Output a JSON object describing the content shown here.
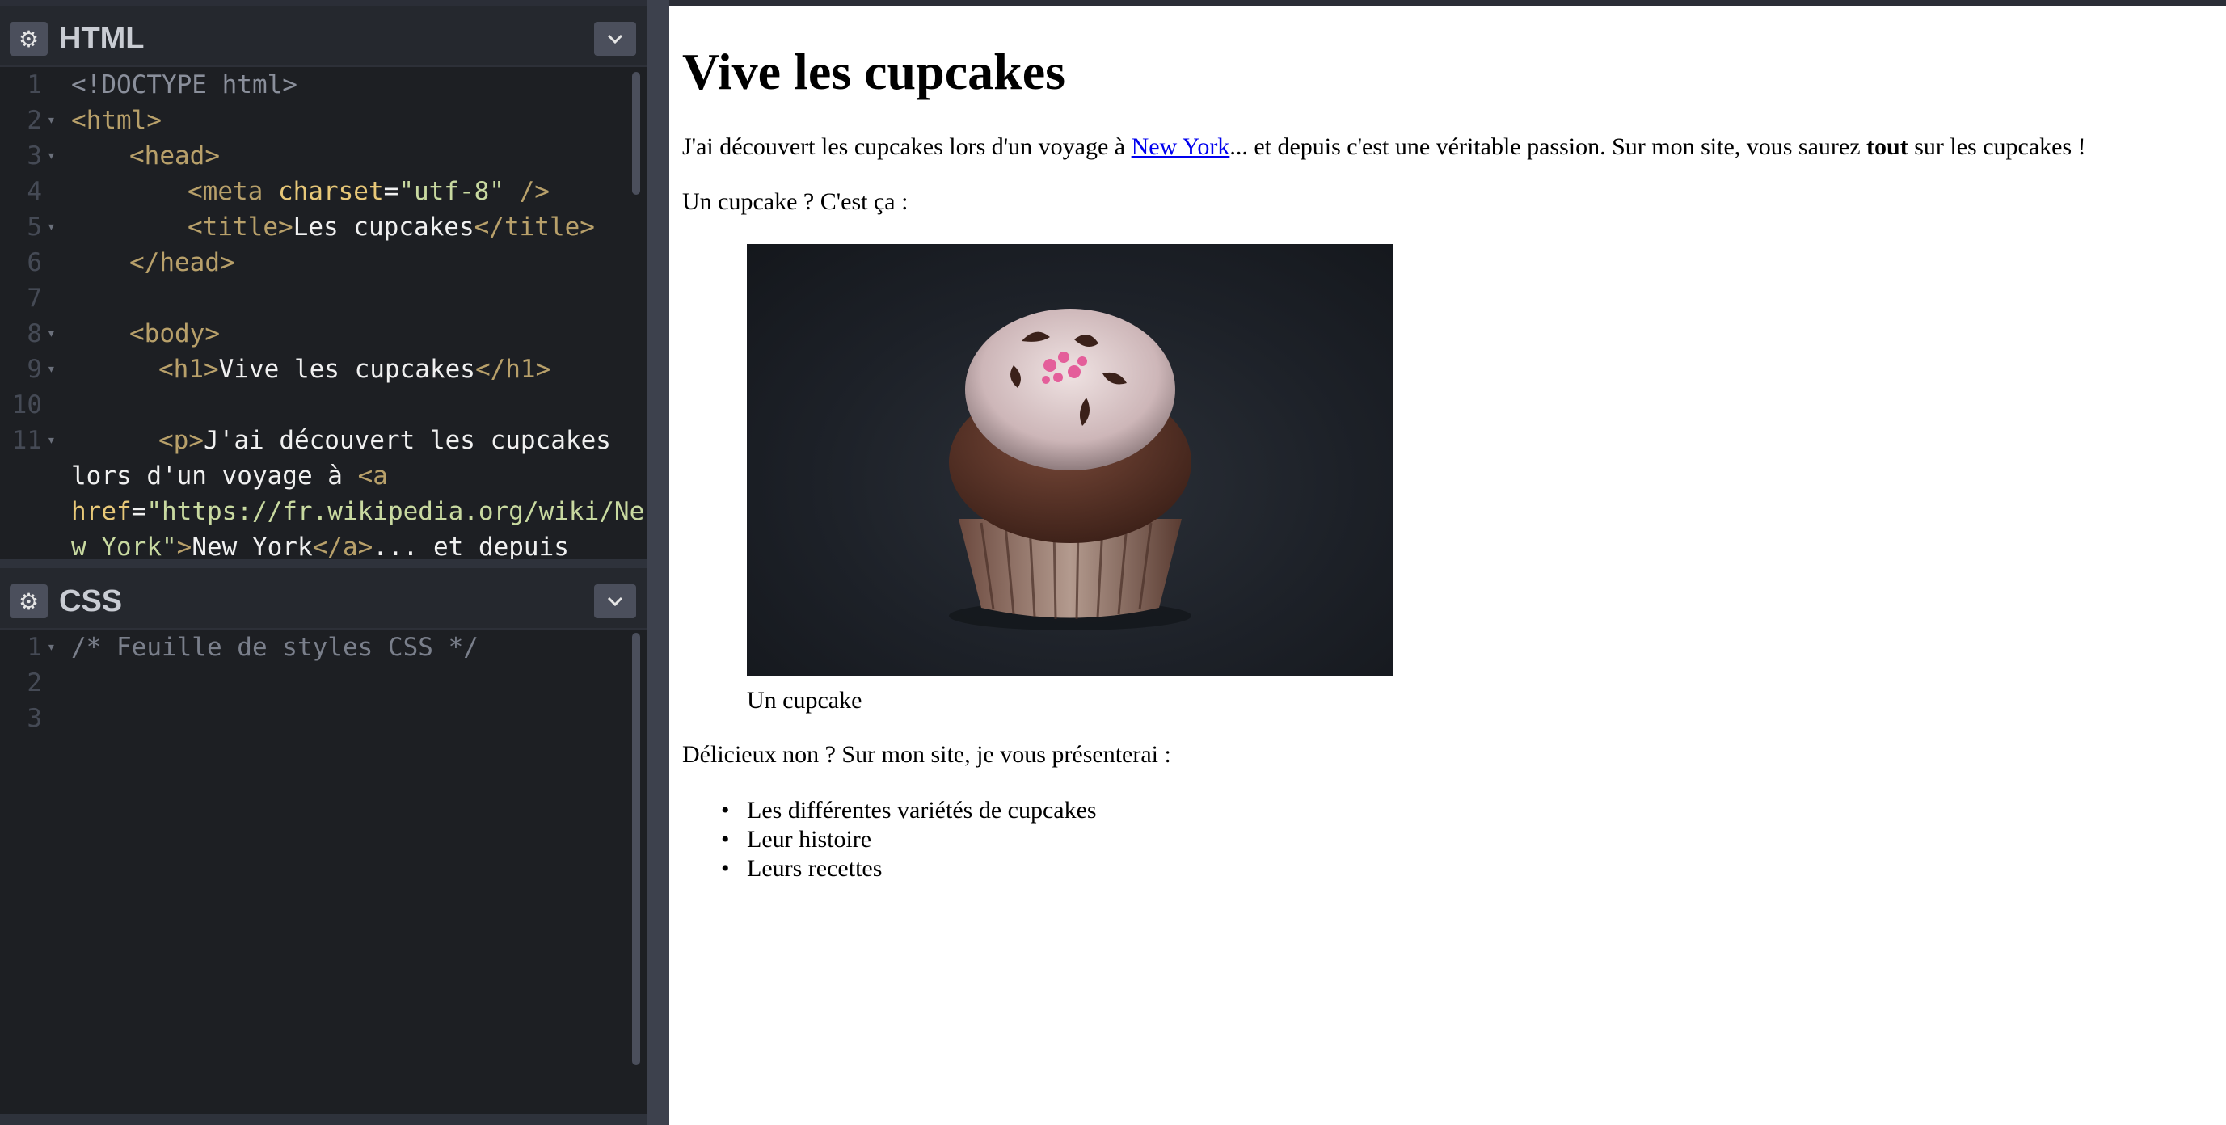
{
  "editors": {
    "html": {
      "title": "HTML",
      "gear_icon": "gear-icon",
      "collapse_icon": "chevron-down-icon",
      "line_numbers": [
        "1",
        "2",
        "3",
        "4",
        "5",
        "6",
        "7",
        "8",
        "9",
        "10",
        "11"
      ],
      "lines": {
        "l1": "<!DOCTYPE html>",
        "l2_open": "<html>",
        "l3_open": "<head>",
        "l4_tag": "<meta ",
        "l4_attr": "charset",
        "l4_eq": "=",
        "l4_val": "\"utf-8\"",
        "l4_close": " />",
        "l5_open": "<title>",
        "l5_text": "Les cupcakes",
        "l5_close": "</title>",
        "l6_close": "</head>",
        "l8_open": "<body>",
        "l9_open": "<h1>",
        "l9_text": "Vive les cupcakes",
        "l9_close": "</h1>",
        "l11_open": "<p>",
        "l11_text": "J'ai découvert les cupcakes",
        "l11b_text": "lors d'un voyage à ",
        "l11b_tag": "<a",
        "l11c_attr": "href",
        "l11c_eq": "=",
        "l11c_val": "\"https://fr.wikipedia.org/wiki/Ne",
        "l11d_val": "w_York\"",
        "l11d_tag": ">",
        "l11d_text": "New York",
        "l11d_close": "</a>",
        "l11d_rest": "... et depuis"
      }
    },
    "css": {
      "title": "CSS",
      "gear_icon": "gear-icon",
      "collapse_icon": "chevron-down-icon",
      "line_numbers": [
        "1",
        "2",
        "3"
      ],
      "comment": "/* Feuille de styles CSS */"
    }
  },
  "preview": {
    "heading": "Vive les cupcakes",
    "intro_before_link": "J'ai découvert les cupcakes lors d'un voyage à ",
    "intro_link": "New York",
    "intro_middle": "... et depuis c'est une véritable passion. Sur mon site, vous saurez ",
    "intro_bold": "tout",
    "intro_after": " sur les cupcakes !",
    "question": "Un cupcake ? C'est ça :",
    "image_subject": "cupcake photo",
    "caption": "Un cupcake",
    "after_text": "Délicieux non ? Sur mon site, je vous présenterai :",
    "list": [
      "Les différentes variétés de cupcakes",
      "Leur histoire",
      "Leurs recettes"
    ]
  },
  "colors": {
    "editor_bg": "#1d1f23",
    "tag": "#b8a06a",
    "attr": "#e8c878",
    "string": "#c8d9a0",
    "link": "#0000ee"
  }
}
